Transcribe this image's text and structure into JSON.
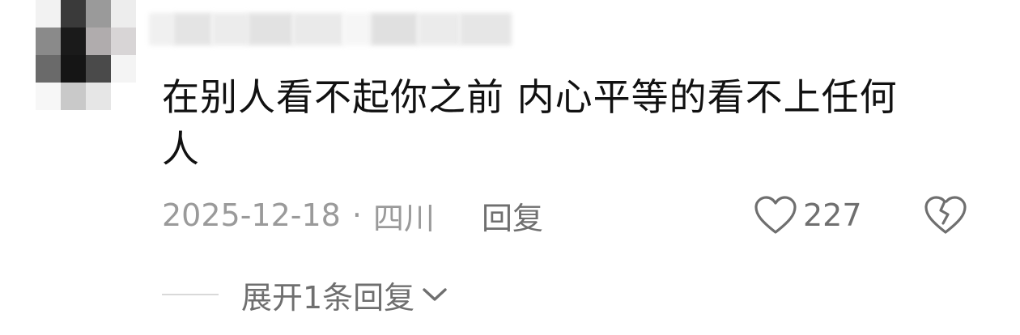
{
  "comment": {
    "text_line1": "在别人看不起你之前 内心平等的看不上任何",
    "text_line2": "人",
    "date": "2025-12-18",
    "separator": "·",
    "location": "四川",
    "reply_label": "回复",
    "like_count": "227",
    "expand_label": "展开1条回复"
  },
  "colors": {
    "text": "#111111",
    "meta": "#9a9a9a",
    "action": "#6f6f6f"
  },
  "icons": {
    "like": "heart-outline-icon",
    "dislike": "broken-heart-icon",
    "expand": "chevron-down-icon"
  }
}
